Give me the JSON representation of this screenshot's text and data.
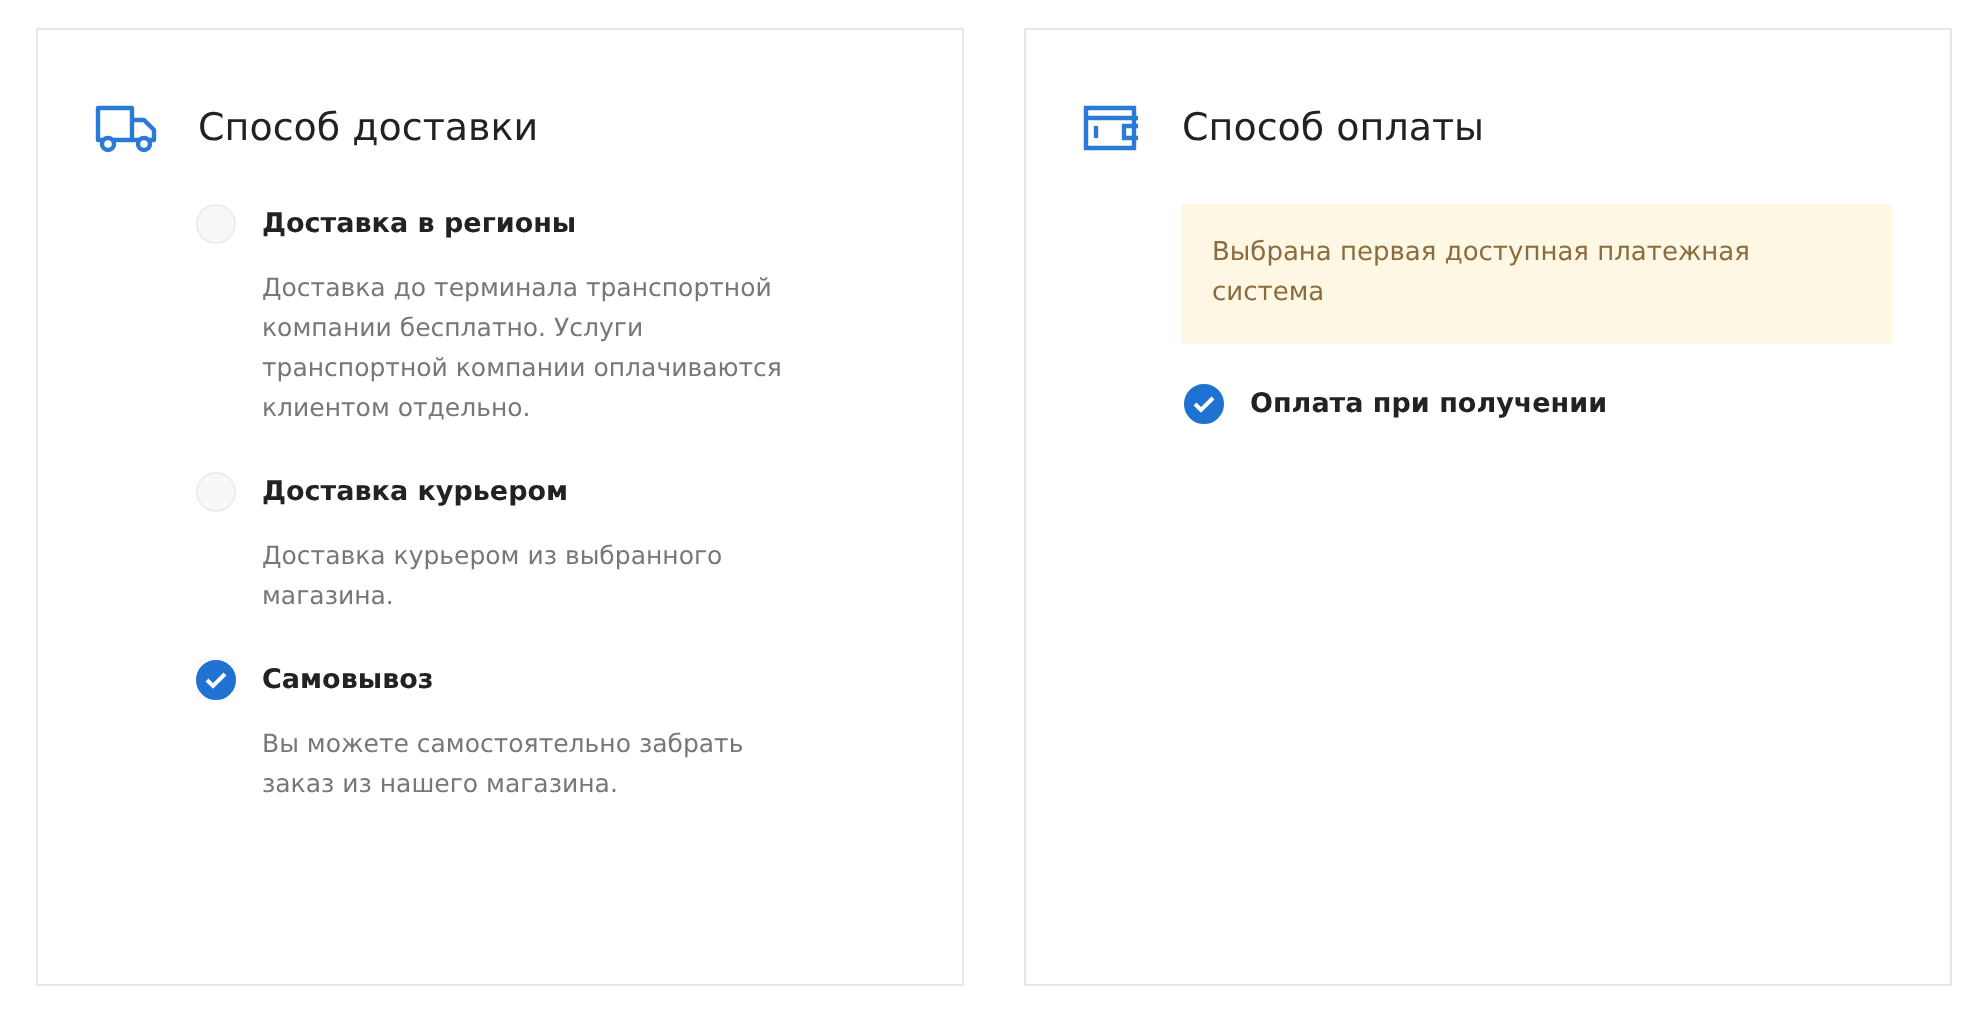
{
  "delivery": {
    "title": "Способ доставки",
    "options": [
      {
        "label": "Доставка в регионы",
        "description": "Доставка до терминала транспортной компании бесплатно. Услуги транспортной компании оплачиваются клиентом отдельно.",
        "selected": false
      },
      {
        "label": "Доставка курьером",
        "description": "Доставка курьером из выбранного магазина.",
        "selected": false
      },
      {
        "label": "Самовывоз",
        "description": "Вы можете самостоятельно забрать заказ из нашего магазина.",
        "selected": true
      }
    ]
  },
  "payment": {
    "title": "Способ оплаты",
    "notice": "Выбрана первая доступная платежная система",
    "options": [
      {
        "label": "Оплата при получении",
        "selected": true
      }
    ]
  }
}
